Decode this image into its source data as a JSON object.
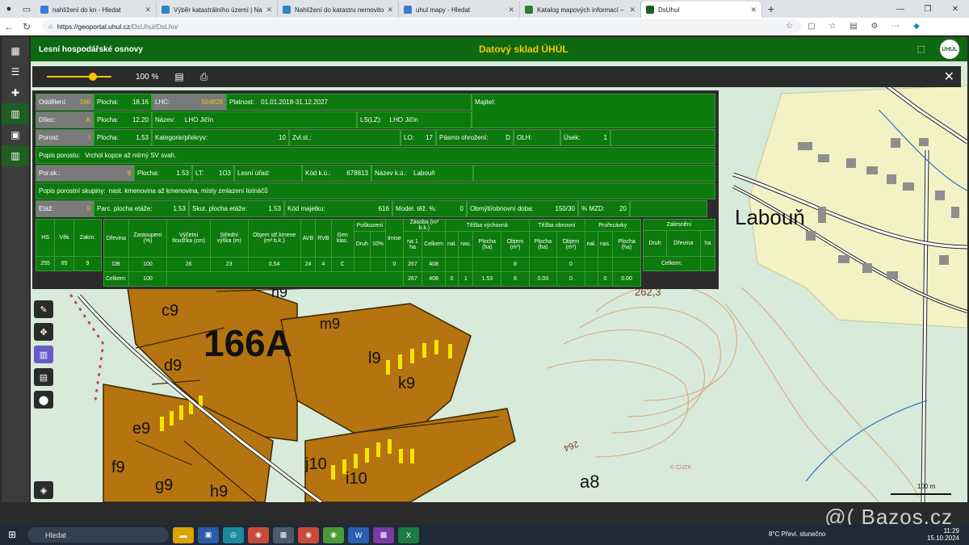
{
  "browser": {
    "tabs": [
      {
        "label": "nahlížení do kn - Hledat",
        "color": "#3a7bd5"
      },
      {
        "label": "Výběr katastrálního území | Nahlí",
        "color": "#2e86c1"
      },
      {
        "label": "Nahlížení do katastru nemovitostí",
        "color": "#2e86c1"
      },
      {
        "label": "uhul mapy - Hledat",
        "color": "#3a7bd5"
      },
      {
        "label": "Katalog mapových informací – w",
        "color": "#2e7d32"
      },
      {
        "label": "DsUhul",
        "color": "#1b5e20"
      }
    ],
    "url_host": "https://geoportal.uhul.cz",
    "url_path": "/DsUhul/DsLho/"
  },
  "app": {
    "section_title": "Lesní hospodářské osnovy",
    "center_title": "Datový sklad ÚHÚL",
    "zoom": "100 %",
    "logo_text": "ÚHÚL"
  },
  "info": {
    "r1": {
      "oddeleni_l": "Oddělení:",
      "oddeleni_v": "166",
      "plocha_l": "Plocha:",
      "plocha_v": "18.16",
      "lhc_l": "LHC:",
      "lhc_v": "504828",
      "platnost_l": "Platnost:",
      "platnost_v": "01.01.2018-31.12.2027",
      "majitel_l": "Majitel:"
    },
    "r2": {
      "dilec_l": "Dílec:",
      "dilec_v": "A",
      "plocha_l": "Plocha:",
      "plocha_v": "12.20",
      "nazev_l": "Název:",
      "nazev_v": "LHO Jičín",
      "ls_l": "LS(LZ):",
      "ls_v": "LHO Jičín"
    },
    "r3": {
      "porost_l": "Porost:",
      "porost_v": "I",
      "plocha_l": "Plocha:",
      "plocha_v": "1.53",
      "kat_l": "Kategorie/překryv:",
      "kat_v": "10",
      "zvl_l": "Zvl.st.:",
      "lo_l": "LO:",
      "lo_v": "17",
      "pasmo_l": "Pásmo ohrožení:",
      "pasmo_v": "D",
      "olh_l": "OLH:",
      "usek_l": "Úsek:",
      "usek_v": "1"
    },
    "r4": {
      "popis_l": "Popis porostu:",
      "popis_v": "Vrchol kopce až mírný SV svah."
    },
    "r5": {
      "porsk_l": "Por.sk.:",
      "porsk_v": "9",
      "plocha_l": "Plocha:",
      "plocha_v": "1.53",
      "lt_l": "LT:",
      "lt_v": "1O3",
      "urad_l": "Lesní úřad:",
      "kodku_l": "Kód k.ú.:",
      "kodku_v": "678813",
      "nazku_l": "Název k.ú.:",
      "nazku_v": "Labouň"
    },
    "r6": {
      "popis_l": "Popis porostní skupiny:",
      "popis_v": "nast. kmenovina až kmenovina, místy zmlazení listnáčů"
    },
    "r7": {
      "etaz_l": "Etáž:",
      "etaz_v": "9",
      "parc_l": "Parc. plocha etáže:",
      "parc_v": "1.53",
      "skut_l": "Skut. plocha etáže:",
      "skut_v": "1.53",
      "kodmaj_l": "Kód majetku:",
      "kodmaj_v": "616",
      "model_l": "Model. těž. %:",
      "model_v": "0",
      "obmyt_l": "Obmýtí/obnovní doba:",
      "obmyt_v": "150/30",
      "mzd_l": "% MZD:",
      "mzd_v": "20"
    }
  },
  "etaz_table": {
    "headers": [
      "HS",
      "Věk",
      "Zakm."
    ],
    "values": [
      "255",
      "85",
      "9"
    ]
  },
  "dreviny_table": {
    "h_group": {
      "poskozeni": "Poškození",
      "zasoba": "Zásoba (m³ b.k.)",
      "tezba_vych": "Těžba výchovná",
      "tezba_obn": "Těžba obnovní",
      "prorezavky": "Prořezávky",
      "zalesneni": "Zalesnění"
    },
    "headers": [
      "Dřevina",
      "Zastoupení (%)",
      "Výčetní tloušťka (cm)",
      "Střední výška (m)",
      "Objem stř.kmene (m³ b.k.)",
      "AVB",
      "RVB",
      "Gen klas.",
      "Druh",
      "10%",
      "Imise",
      "na 1 ha",
      "Celkem",
      "nal.",
      "nas.",
      "Plocha (ha)",
      "Objem (m³)",
      "Plocha (ha)",
      "Objem (m³)",
      "nal.",
      "nas.",
      "Plocha (ha)"
    ],
    "row": [
      "DB",
      "100",
      "26",
      "23",
      "0.54",
      "24",
      "4",
      "C",
      "",
      "",
      "0",
      "267",
      "408",
      "",
      "",
      "",
      "8",
      "",
      "0",
      "",
      "",
      ""
    ],
    "total_label": "Celkem:",
    "total": [
      "100",
      "267",
      "408",
      "0",
      "1",
      "1.53",
      "8",
      "0.00",
      "0",
      "0",
      "0.00"
    ],
    "zal_headers": [
      "Druh",
      "Dřevina",
      "ha"
    ],
    "zal_total_label": "Celkem:"
  },
  "map": {
    "labels": {
      "big": "166A",
      "place": "Labouň",
      "height": "262,3",
      "contour": "264",
      "c": "c9",
      "d": "d9",
      "e": "e9",
      "f": "f9",
      "g": "g9",
      "h": "h9",
      "i": "i10",
      "j": "j10",
      "k": "k9",
      "l": "l9",
      "m": "m9",
      "n": "n9",
      "a8": "a8",
      "copyright": "© ČÚZK",
      "scale": "100 m"
    }
  },
  "taskbar": {
    "search": "Hledat",
    "weather": "8°C  Převl. slunečno",
    "time": "11:29",
    "date": "15.10.2024"
  },
  "watermark": "@( Bazos.cz"
}
